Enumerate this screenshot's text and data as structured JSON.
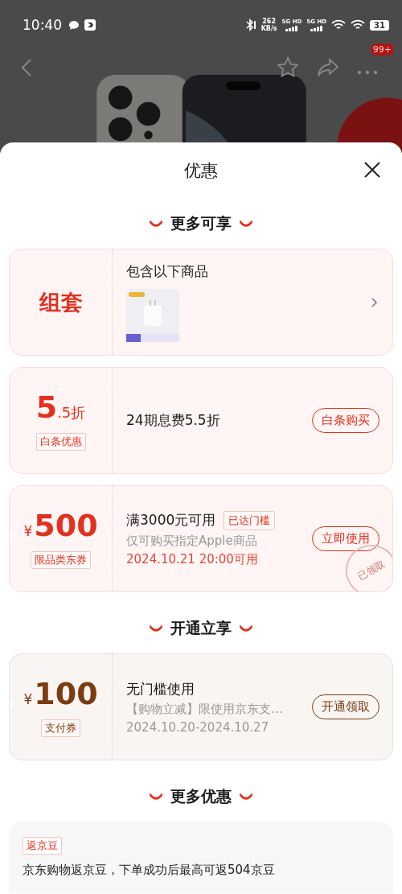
{
  "status_bar": {
    "time": "10:40",
    "speed": "262",
    "speed_unit": "KB/s",
    "networks": [
      "5G HD",
      "5G HD"
    ],
    "battery": "31"
  },
  "nav": {
    "badge": "99+"
  },
  "sheet": {
    "title": "优惠",
    "sections": [
      {
        "heading": "更多可享",
        "cards": [
          {
            "kind": "bundle",
            "color": "#e2311f",
            "label": "组套",
            "title": "包含以下商品"
          },
          {
            "kind": "discount",
            "color": "#e2311f",
            "big": "5",
            "small": ".5折",
            "tag": "白条优惠",
            "title": "24期息费5.5折",
            "button": "白条购买"
          },
          {
            "kind": "coupon",
            "color": "#e2311f",
            "currency": "¥",
            "amount": "500",
            "tag": "限品类东券",
            "title": "满3000元可用",
            "badge": "已达门槛",
            "desc": "仅可购买指定Apple商品",
            "date": "2024.10.21 20:00可用",
            "date_highlight": true,
            "button": "立即使用",
            "stamp": "已领取"
          }
        ]
      },
      {
        "heading": "开通立享",
        "cards": [
          {
            "kind": "coupon",
            "color": "#7a3c10",
            "currency": "¥",
            "amount": "100",
            "tag": "支付券",
            "title": "无门槛使用",
            "desc": "【购物立减】限使用京东支…",
            "date": "2024.10.20-2024.10.27",
            "date_highlight": false,
            "button": "开通领取"
          }
        ]
      },
      {
        "heading": "更多优惠",
        "cards": [
          {
            "kind": "note",
            "color": "#e2311f",
            "tag": "返京豆",
            "text": "京东购物返京豆，下单成功后最高可返504京豆"
          }
        ]
      }
    ]
  }
}
